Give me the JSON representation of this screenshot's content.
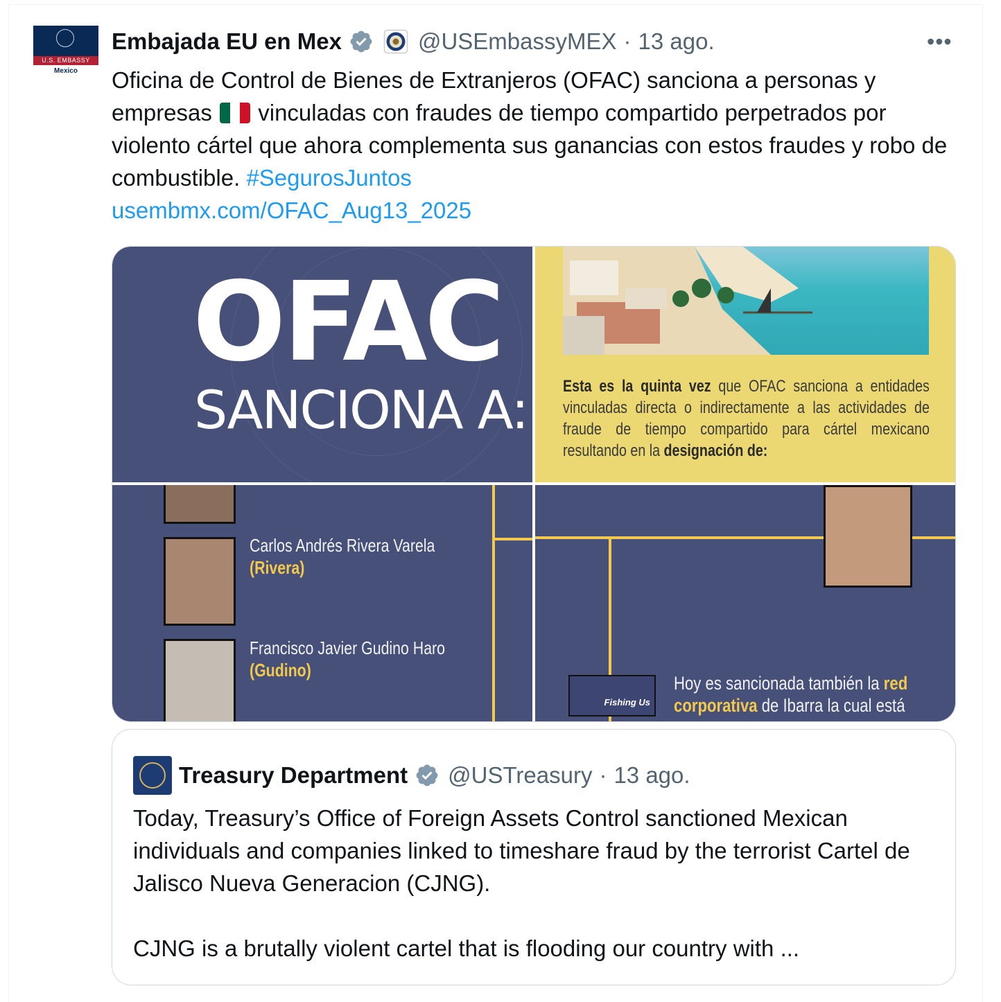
{
  "tweet": {
    "author_name": "Embajada EU en Mex",
    "handle": "@USEmbassyMEX",
    "separator": "·",
    "date": "13 ago.",
    "more_label": "•••",
    "avatar": {
      "band_text": "U.S. EMBASSY",
      "location_text": "Mexico"
    },
    "text_part1": "Oficina de Control de Bienes de Extranjeros (OFAC) sanciona a personas y empresas",
    "text_part2": "vinculadas con fraudes de tiempo compartido perpetrados por violento cártel que ahora complementa sus ganancias con estos fraudes y robo de combustible.",
    "hashtag": "#SegurosJuntos",
    "link": "usembmx.com/OFAC_Aug13_2025",
    "flag_icon": "mexico-flag-icon",
    "colors": {
      "link": "#1d9bf0",
      "verified": "#829aab",
      "secondary": "#536471"
    }
  },
  "media": {
    "tile1": {
      "title": "OFAC",
      "subtitle": "SANCIONA A:"
    },
    "tile2": {
      "bold_lead": "Esta es la quinta vez",
      "text1": " que OFAC sanciona a entidades vinculadas directa o indirectamente a las actividades de fraude de tiempo compartido para cártel mexicano resultando en la ",
      "bold_tail": "designación de:"
    },
    "tile3": {
      "person1": {
        "name": "Carlos Andrés Rivera Varela",
        "alias": "(Rivera)"
      },
      "person2": {
        "name": "Francisco Javier Gudino Haro",
        "alias": "(Gudino)"
      }
    },
    "tile4": {
      "logo_text": "Fishing Us",
      "line1_text": "Hoy es sancionada también la ",
      "line1_bold": "red",
      "line2_bold": "corporativa",
      "line2_text": " de Ibarra la cual está"
    },
    "colors": {
      "navy": "#465079",
      "yellow": "#ecd873",
      "gold": "#f2c94c"
    }
  },
  "quoted": {
    "author_name": "Treasury Department",
    "handle": "@USTreasury",
    "separator": "·",
    "date": "13 ago.",
    "text": "Today, Treasury’s Office of Foreign Assets Control sanctioned Mexican individuals and companies linked to timeshare fraud by the terrorist Cartel de Jalisco Nueva Generacion (CJNG).\n\nCJNG is a brutally violent cartel that is flooding our country with ..."
  }
}
